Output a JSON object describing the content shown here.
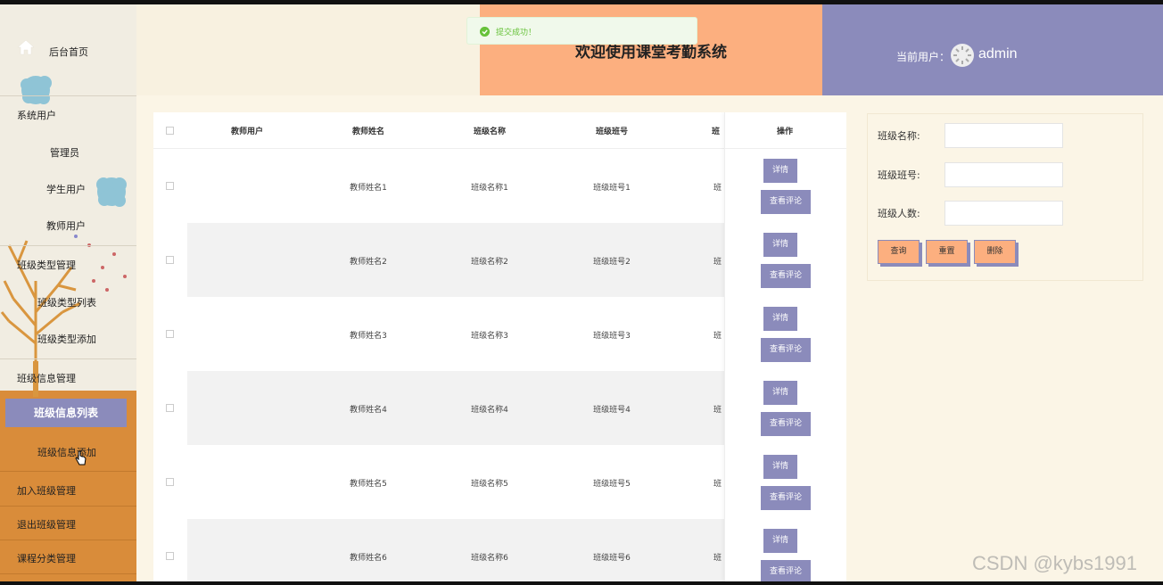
{
  "sidebar": {
    "home": "后台首页",
    "groups": [
      {
        "label": "系统用户",
        "items": [
          "管理员",
          "学生用户",
          "教师用户"
        ]
      },
      {
        "label": "班级类型管理",
        "items": [
          "班级类型列表",
          "班级类型添加"
        ]
      },
      {
        "label": "班级信息管理",
        "items": [
          "班级信息列表",
          "班级信息添加"
        ]
      },
      {
        "label": "加入班级管理",
        "items": []
      },
      {
        "label": "退出班级管理",
        "items": []
      },
      {
        "label": "课程分类管理",
        "items": []
      }
    ],
    "active_item": "班级信息列表"
  },
  "header": {
    "title": "欢迎使用课堂考勤系统",
    "user_label": "当前用户：",
    "user_name": "admin"
  },
  "toast": {
    "message": "提交成功！",
    "type": "success"
  },
  "table": {
    "columns": [
      "教师用户",
      "教师姓名",
      "班级名称",
      "班级班号",
      "班",
      "操作"
    ],
    "rows": [
      {
        "teacher_name": "教师姓名1",
        "class_name": "班级名称1",
        "class_no": "班级班号1",
        "partial": "班"
      },
      {
        "teacher_name": "教师姓名2",
        "class_name": "班级名称2",
        "class_no": "班级班号2",
        "partial": "班"
      },
      {
        "teacher_name": "教师姓名3",
        "class_name": "班级名称3",
        "class_no": "班级班号3",
        "partial": "班"
      },
      {
        "teacher_name": "教师姓名4",
        "class_name": "班级名称4",
        "class_no": "班级班号4",
        "partial": "班"
      },
      {
        "teacher_name": "教师姓名5",
        "class_name": "班级名称5",
        "class_no": "班级班号5",
        "partial": "班"
      },
      {
        "teacher_name": "教师姓名6",
        "class_name": "班级名称6",
        "class_no": "班级班号6",
        "partial": "班"
      }
    ],
    "detail_label": "详情",
    "comment_label": "查看评论"
  },
  "search": {
    "fields": [
      {
        "label": "班级名称:",
        "value": ""
      },
      {
        "label": "班级班号:",
        "value": ""
      },
      {
        "label": "班级人数:",
        "value": ""
      }
    ],
    "query_label": "查询",
    "reset_label": "重置",
    "delete_label": "删除"
  },
  "watermark": "CSDN @kybs1991",
  "colors": {
    "accent_purple": "#8b8bbb",
    "accent_orange": "#fcaf7f",
    "sidebar_orange": "#d98c3a",
    "page_bg": "#fbf5e6",
    "success_green": "#67c23a"
  },
  "icons": [
    "home-icon",
    "success-check-icon",
    "user-avatar-icon"
  ]
}
